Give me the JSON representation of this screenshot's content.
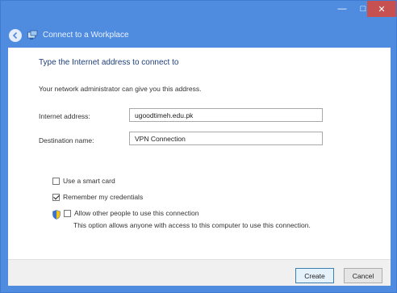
{
  "window": {
    "minimize_glyph": "—",
    "maximize_glyph": "□",
    "close_glyph": "✕"
  },
  "nav": {
    "title": "Connect to a Workplace",
    "back_icon": "back-arrow-icon",
    "app_icon": "workplace-connection-icon"
  },
  "content": {
    "heading": "Type the Internet address to connect to",
    "subtext": "Your network administrator can give you this address.",
    "fields": [
      {
        "label": "Internet address:",
        "value": "ugoodtimeh.edu.pk"
      },
      {
        "label": "Destination name:",
        "value": "VPN Connection"
      }
    ],
    "checkboxes": [
      {
        "label": "Use a smart card",
        "checked": false
      },
      {
        "label": "Remember my credentials",
        "checked": true
      },
      {
        "label": "Allow other people to use this connection",
        "checked": false
      }
    ],
    "allow_desc": "This option allows anyone with access to this computer to use this connection.",
    "shield_icon": "uac-shield-icon"
  },
  "footer": {
    "create_label": "Create",
    "cancel_label": "Cancel"
  },
  "colors": {
    "frame": "#4f8ce0",
    "close_button": "#c75050",
    "heading": "#1f3f7a"
  }
}
